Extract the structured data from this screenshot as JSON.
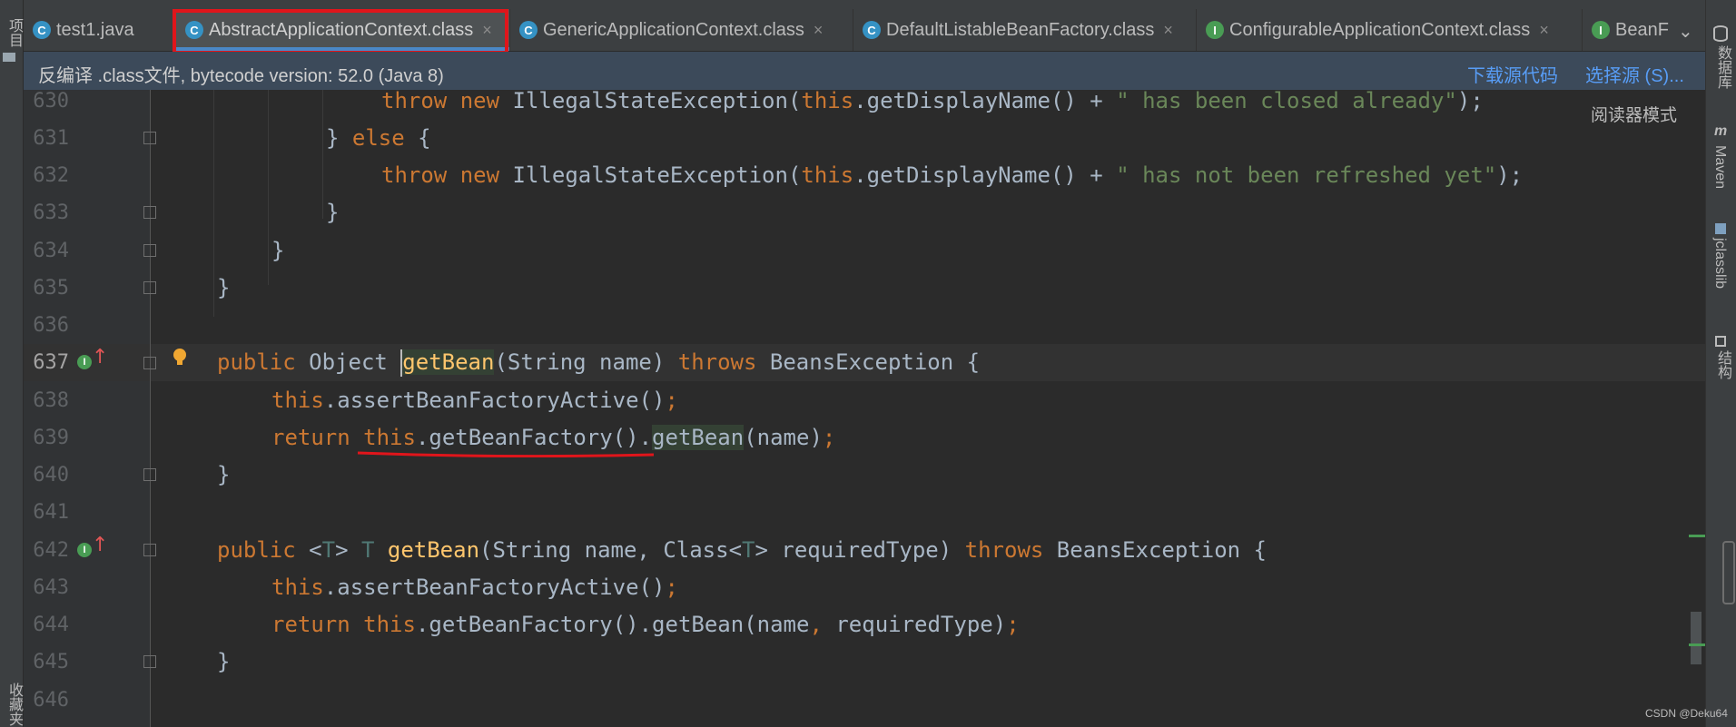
{
  "left_strip": {
    "project_label": "项目",
    "bookmarks_label": "收藏夹"
  },
  "tabs": [
    {
      "label": "test1.java",
      "icon": "java-class-icon",
      "icon_letter": "C",
      "color": "#3592c4"
    },
    {
      "label": "AbstractApplicationContext.class",
      "icon": "class-file-icon",
      "icon_letter": "C",
      "color": "#3592c4",
      "active": true
    },
    {
      "label": "GenericApplicationContext.class",
      "icon": "class-file-icon",
      "icon_letter": "C",
      "color": "#3592c4"
    },
    {
      "label": "DefaultListableBeanFactory.class",
      "icon": "class-file-icon",
      "icon_letter": "C",
      "color": "#3592c4"
    },
    {
      "label": "ConfigurableApplicationContext.class",
      "icon": "interface-file-icon",
      "icon_letter": "I",
      "color": "#499c54"
    },
    {
      "label": "BeanF",
      "icon": "interface-file-icon",
      "icon_letter": "I",
      "color": "#499c54"
    }
  ],
  "decompile_bar": {
    "message": "反编译 .class文件, bytecode version: 52.0 (Java 8)",
    "download_link": "下载源代码",
    "choose_link": "选择源 (S)..."
  },
  "reader_mode": "阅读器模式",
  "right_strip": {
    "database": "数据库",
    "maven": "Maven",
    "jclasslib": "jclasslib",
    "structure": "结构"
  },
  "editor": {
    "line_numbers": [
      "630",
      "631",
      "632",
      "633",
      "634",
      "635",
      "636",
      "637",
      "638",
      "639",
      "640",
      "641",
      "642",
      "643",
      "644",
      "645",
      "646"
    ],
    "current_line": "637"
  },
  "code_text": {
    "throw": "throw",
    "new": "new",
    "ise": "IllegalStateException(",
    "this": "this",
    "getDisplayName": ".getDisplayName() + ",
    "closed_str": "\" has been closed already\"",
    "refreshed_str": "\" has not been refreshed yet\"",
    "semi_close": ");",
    "else_close": "} ",
    "else": "else",
    "brace_open": " {",
    "brace_close": "}",
    "public": "public",
    "object": " Object ",
    "getBean": "getBean",
    "sig1_rest": "(String name) ",
    "throws": "throws",
    "beans_exc": " BeansException {",
    "assert_call": ".assertBeanFactoryActive()",
    "semi": ";",
    "return": "return",
    "getBeanFactory": ".getBeanFactory()",
    "dot": ".",
    "name_arg": "(name)",
    "generic_open": " <",
    "T": "T",
    "generic_close": "> ",
    "T_space": " ",
    "sig2_rest": "(String name, Class<",
    "sig2_rest2": "> requiredType) ",
    "getbean2": ".getBean(name",
    "comma": ",",
    "required": " requiredType)"
  },
  "watermark": "CSDN @Deku64"
}
